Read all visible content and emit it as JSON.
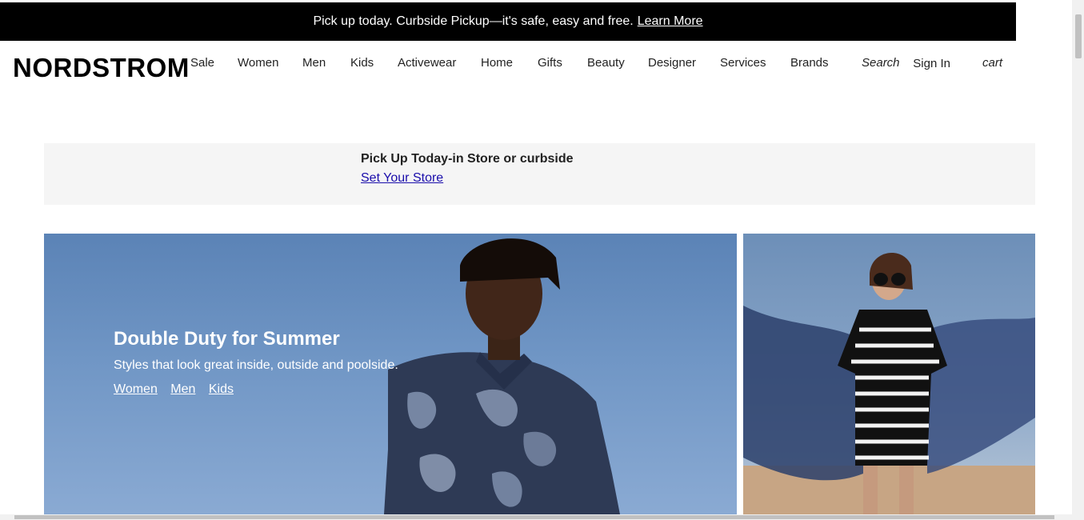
{
  "promo": {
    "text": "Pick up today. Curbside Pickup—it's safe, easy and free.",
    "link": "Learn More"
  },
  "header": {
    "logo": "NORDSTROM",
    "nav": [
      "Sale",
      "Women",
      "Men",
      "Kids",
      "Activewear",
      "Home",
      "Gifts",
      "Beauty",
      "Designer",
      "Services",
      "Brands"
    ],
    "search": "Search",
    "signin": "Sign In",
    "cart": "cart"
  },
  "store": {
    "title": "Pick Up Today-in Store or curbside",
    "link": "Set Your Store"
  },
  "hero": {
    "title": "Double Duty for Summer",
    "subtitle": "Styles that look great inside, outside and poolside.",
    "links": [
      "Women",
      "Men",
      "Kids"
    ]
  },
  "colors": {
    "promo_bg": "#000000",
    "link_blue": "#1a0dab",
    "strip_bg": "#f5f5f5",
    "hero_sky": "#6b90c2"
  }
}
